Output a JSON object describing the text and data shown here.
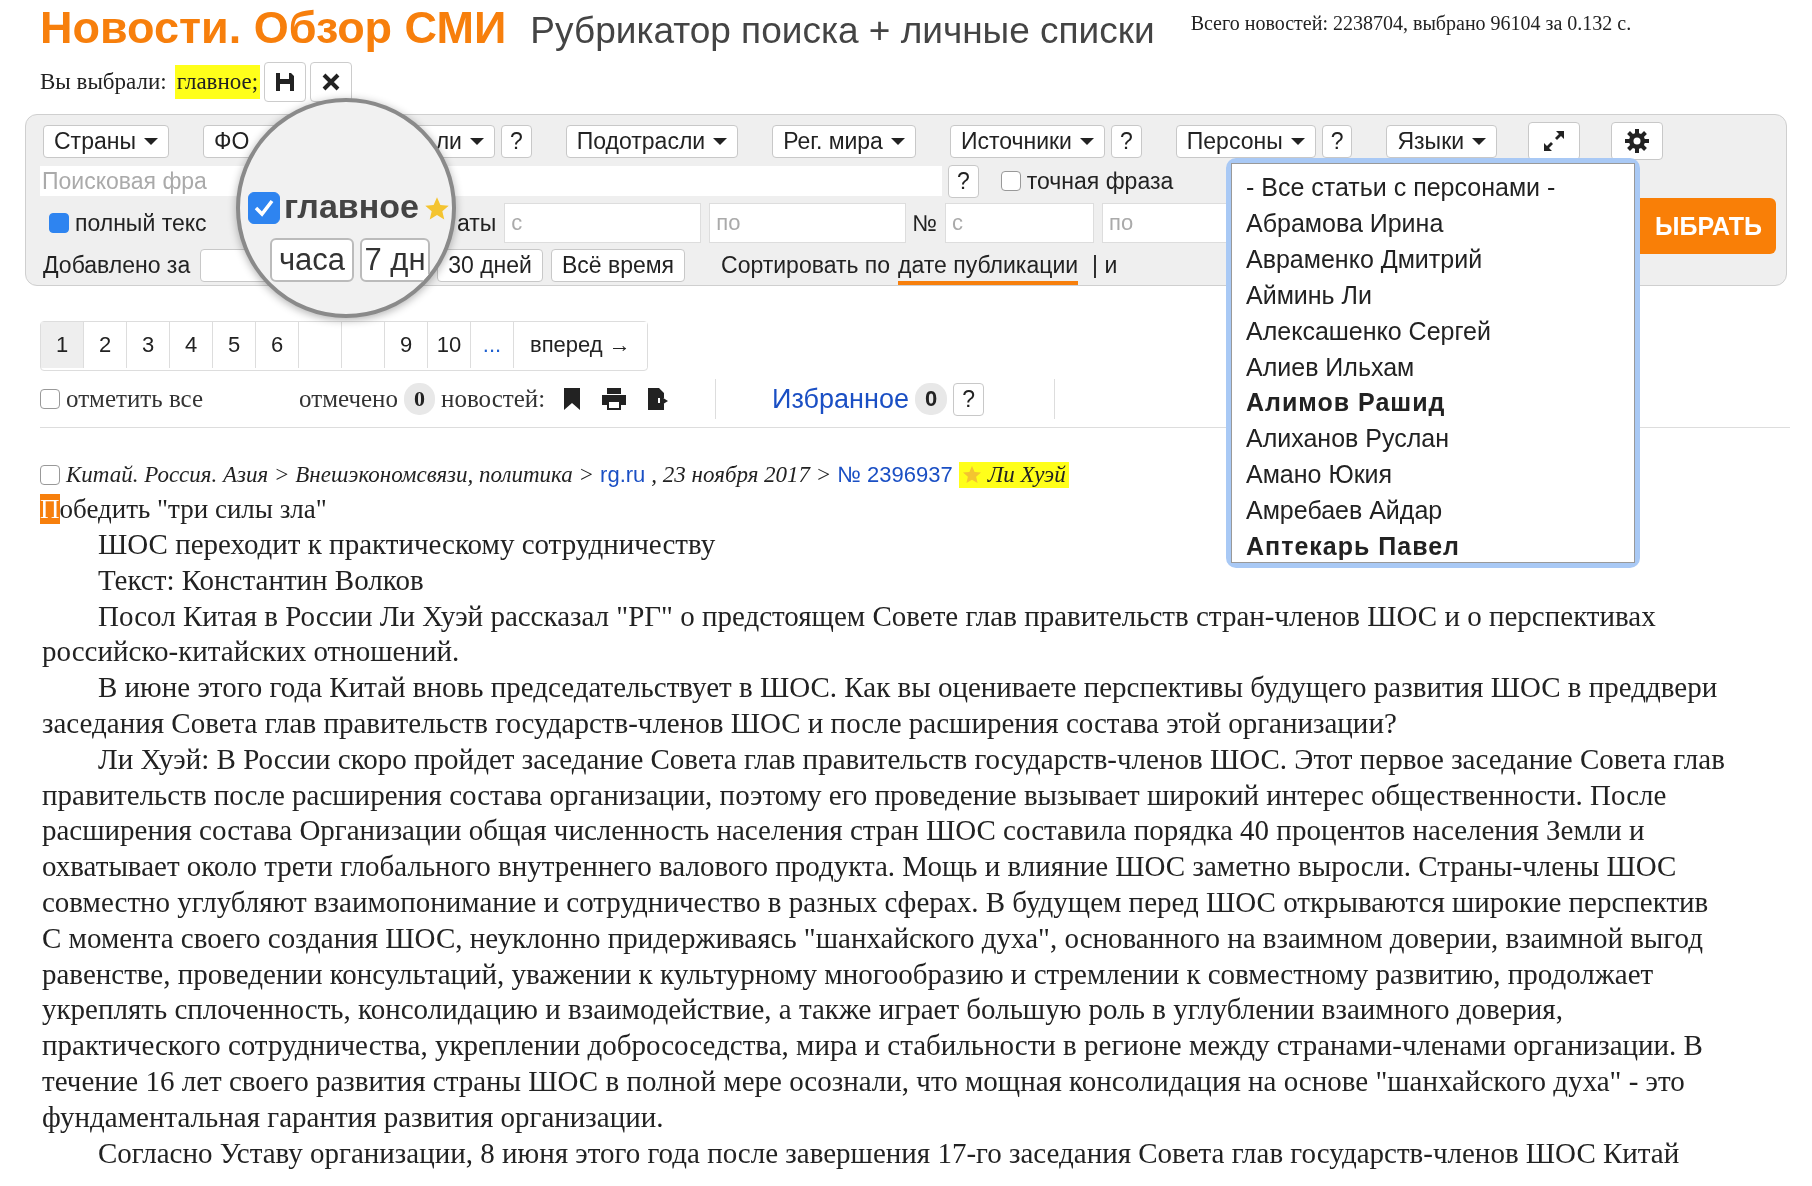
{
  "header": {
    "title": "Новости. Обзор СМИ",
    "subtitle": "Рубрикатор поиска + личные списки",
    "stats": "Всего новостей: 2238704, выбрано 96104 за 0.132 с."
  },
  "selection": {
    "label": "Вы выбрали:",
    "chips": [
      "главное;"
    ]
  },
  "toolbar": {
    "filters": [
      {
        "kind": "dropdown",
        "label": "Страны"
      },
      {
        "kind": "split",
        "label": "ФО",
        "label_end": "ли"
      },
      {
        "kind": "help",
        "label": "?"
      },
      {
        "kind": "dropdown",
        "label": "Подотрасли"
      },
      {
        "kind": "dropdown",
        "label": "Рег. мира"
      },
      {
        "kind": "dropdown",
        "label": "Источники"
      },
      {
        "kind": "help",
        "label": "?"
      },
      {
        "kind": "dropdown",
        "label": "Персоны"
      },
      {
        "kind": "help",
        "label": "?"
      },
      {
        "kind": "dropdown",
        "label": "Языки"
      },
      {
        "kind": "expand"
      },
      {
        "kind": "settings"
      }
    ],
    "search": {
      "placeholder": "Поисковая фра",
      "help": "?"
    },
    "exact_phrase": {
      "label": "точная фраза",
      "checked": false
    },
    "full_text": {
      "label": "полный текс",
      "checked": true
    },
    "date_label": "аты",
    "date_from": {
      "placeholder": "с"
    },
    "date_to": {
      "placeholder": "по"
    },
    "number_label": "№",
    "number_from": {
      "placeholder": "с"
    },
    "number_to": {
      "placeholder": "по"
    },
    "submit": "ЫБРАТЬ",
    "added_label": "Добавлено за",
    "periods": [
      "30 дней",
      "Всё время"
    ],
    "sort_label": "Сортировать по",
    "sort_options": [
      {
        "label": "дате публикации",
        "selected": true
      }
    ],
    "sort_more": "| и"
  },
  "magnifier": {
    "checkbox": {
      "label": "главное",
      "checked": true,
      "starred": true
    },
    "buttons": [
      "часа",
      "7 дн"
    ]
  },
  "pagination": {
    "pages": [
      {
        "kind": "page",
        "label": "1",
        "selected": true
      },
      {
        "kind": "page",
        "label": "2",
        "selected": false
      },
      {
        "kind": "page",
        "label": "3",
        "selected": false
      },
      {
        "kind": "page",
        "label": "4",
        "selected": false
      },
      {
        "kind": "page",
        "label": "5",
        "selected": false
      },
      {
        "kind": "page",
        "label": "6",
        "selected": false
      },
      {
        "kind": "hidden"
      },
      {
        "kind": "hidden"
      },
      {
        "kind": "page",
        "label": "9",
        "selected": false
      },
      {
        "kind": "page",
        "label": "10",
        "selected": false
      },
      {
        "kind": "more",
        "label": "..."
      },
      {
        "kind": "next",
        "label": "вперед →"
      }
    ]
  },
  "actions": {
    "select_all": {
      "label": "отметить все",
      "checked": false
    },
    "marked_label": "отмечено",
    "marked_count": "0",
    "news_label": "новостей:",
    "favorites": "Избранное",
    "favorites_count": "0",
    "help": "?"
  },
  "article": {
    "checked": false,
    "rubrics": "Китай. Россия. Азия > Внешэкономсвязи, политика >",
    "source": "rg.ru",
    "date": ", 23 ноября 2017 >",
    "number": "№ 2396937",
    "person": "Ли Хуэй",
    "title_mark": "П",
    "title": "обедить \"три силы зла\"",
    "paragraphs": [
      {
        "lines": [
          "ШОС переходит к практическому сотрудничеству"
        ]
      },
      {
        "lines": [
          "Текст: Константин Волков"
        ]
      },
      {
        "lines": [
          "Посол Китая в России Ли Хуэй рассказал \"РГ\" о предстоящем Совете глав правительств стран-членов ШОС и о перспективах",
          "российско-китайских отношений."
        ]
      },
      {
        "lines": [
          "В июне этого года Китай вновь председательствует в ШОС. Как вы оцениваете перспективы будущего развития ШОС в преддвери",
          "заседания Совета глав правительств государств-членов ШОС и после расширения состава этой организации?"
        ]
      },
      {
        "lines": [
          "Ли Хуэй: В России скоро пройдет заседание Совета глав правительств государств-членов ШОС. Этот первое заседание Совета глав",
          "правительств после расширения состава организации, поэтому его проведение вызывает широкий интерес общественности. После",
          "расширения состава Организации общая численность населения стран ШОС составила порядка 40 процентов населения Земли и",
          "охватывает около трети глобального внутреннего валового продукта. Мощь и влияние ШОС заметно выросли. Страны-члены ШОС",
          "совместно углубляют взаимопонимание и сотрудничество в разных сферах. В будущем перед ШОС открываются широкие перспектив",
          "С момента своего создания ШОС, неуклонно придерживаясь \"шанхайского духа\", основанного на взаимном доверии, взаимной выгод",
          "равенстве, проведении консультаций, уважении к культурному многообразию и стремлении к совместному развитию, продолжает",
          "укреплять сплоченность, консолидацию и взаимодействие, а также играет большую роль в углублении взаимного доверия,",
          "практического сотрудничества, укреплении добрососедства, мира и стабильности в регионе между странами-членами организации. В",
          "течение 16 лет своего развития страны ШОС в полной мере осознали, что мощная консолидация на основе \"шанхайского духа\" - это",
          "фундаментальная гарантия развития организации."
        ]
      },
      {
        "lines": [
          "Согласно Уставу организации, 8 июня этого года после завершения 17-го заседания Совета глав государств-членов ШОС Китай"
        ]
      }
    ]
  },
  "persons_dropdown": {
    "items": [
      {
        "label": "- Все статьи с персонами -",
        "emphasized": false
      },
      {
        "label": "Абрамова Ирина",
        "emphasized": false
      },
      {
        "label": "Авраменко Дмитрий",
        "emphasized": false
      },
      {
        "label": "Айминь Ли",
        "emphasized": false
      },
      {
        "label": "Алексашенко Сергей",
        "emphasized": false
      },
      {
        "label": "Алиев Ильхам",
        "emphasized": false
      },
      {
        "label": "Алимов Рашид",
        "emphasized": true
      },
      {
        "label": "Алиханов Руслан",
        "emphasized": false
      },
      {
        "label": "Амано Юкия",
        "emphasized": false
      },
      {
        "label": "Амребаев Айдар",
        "emphasized": false
      },
      {
        "label": "Аптекарь Павел",
        "emphasized": true
      }
    ]
  }
}
